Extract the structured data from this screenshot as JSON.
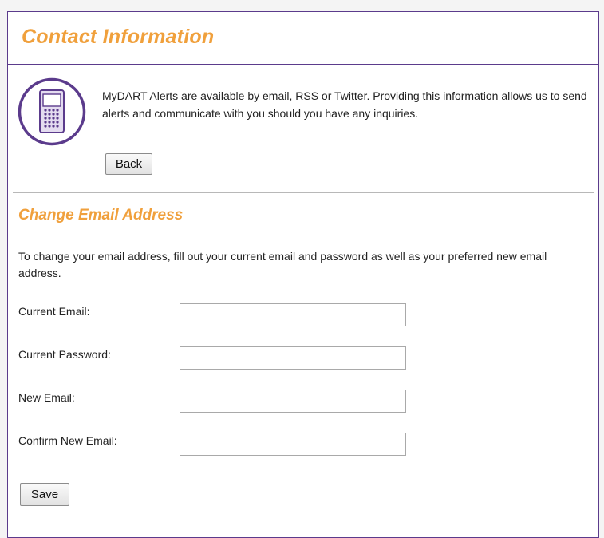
{
  "header": {
    "title": "Contact Information"
  },
  "intro": {
    "icon": "mobile-phone-icon",
    "text": "MyDART Alerts are available by email, RSS or Twitter. Providing this information allows us to send alerts and communicate with you should you have any inquiries.",
    "back_label": "Back"
  },
  "change_email": {
    "title": "Change Email Address",
    "description": "To change your email address, fill out your current email and password as well as your preferred new email address.",
    "fields": [
      {
        "label": "Current Email:",
        "value": ""
      },
      {
        "label": "Current Password:",
        "value": ""
      },
      {
        "label": "New Email:",
        "value": ""
      },
      {
        "label": "Confirm New Email:",
        "value": ""
      }
    ],
    "save_label": "Save"
  },
  "colors": {
    "accent": "#f0a03c",
    "border": "#5b3b8c"
  }
}
